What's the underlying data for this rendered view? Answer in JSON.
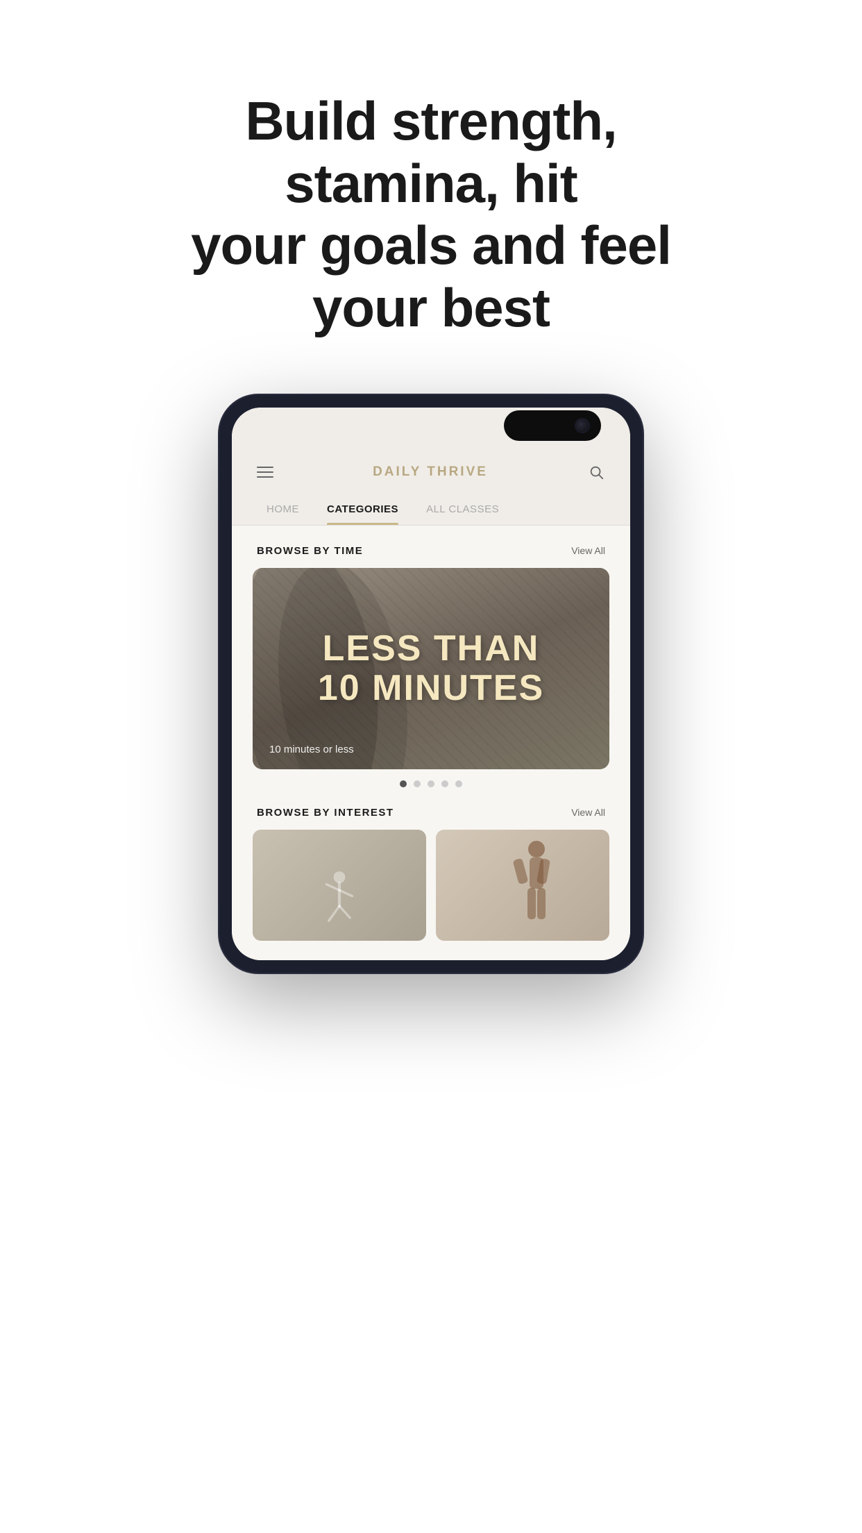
{
  "hero": {
    "headline_line1": "Build strength, stamina, hit",
    "headline_line2": "your goals and feel your best"
  },
  "app": {
    "logo": "DAILY THRIVE"
  },
  "nav": {
    "tabs": [
      {
        "id": "home",
        "label": "HOME",
        "active": false
      },
      {
        "id": "categories",
        "label": "CATEGORIES",
        "active": true
      },
      {
        "id": "all_classes",
        "label": "ALL CLASSES",
        "active": false
      }
    ]
  },
  "browse_time": {
    "section_title": "BROWSE BY TIME",
    "view_all": "View All",
    "banner": {
      "headline_line1": "LESS THAN",
      "headline_line2": "10 MINUTES",
      "subtitle": "10 minutes or less"
    },
    "dots": [
      {
        "active": true
      },
      {
        "active": false
      },
      {
        "active": false
      },
      {
        "active": false
      },
      {
        "active": false
      }
    ]
  },
  "browse_interest": {
    "section_title": "BROWSE BY INTEREST",
    "view_all": "View All"
  },
  "icons": {
    "hamburger": "☰",
    "search": "🔍"
  }
}
